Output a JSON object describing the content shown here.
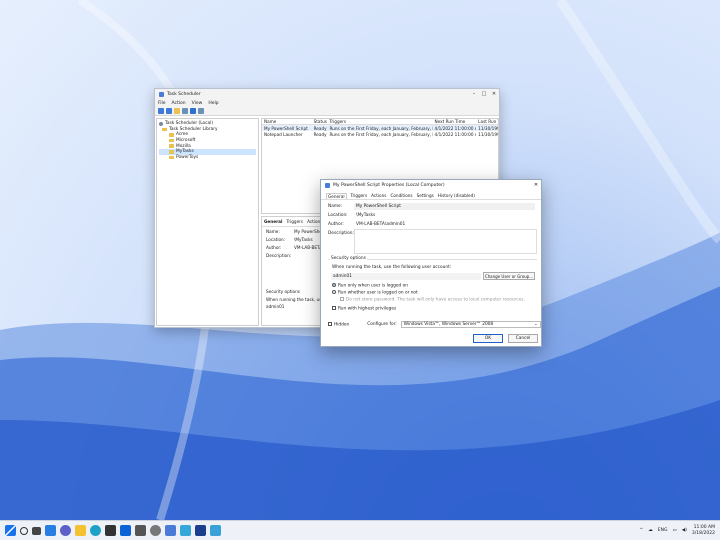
{
  "window": {
    "title": "Task Scheduler",
    "menu": [
      "File",
      "Action",
      "View",
      "Help"
    ],
    "tree": [
      {
        "label": "Task Scheduler (Local)",
        "level": 0,
        "icon": "clock-icon"
      },
      {
        "label": "Task Scheduler Library",
        "level": 1,
        "icon": "folder-icon"
      },
      {
        "label": "Acme",
        "level": 2,
        "icon": "folder-icon"
      },
      {
        "label": "Microsoft",
        "level": 2,
        "icon": "folder-icon"
      },
      {
        "label": "Mozilla",
        "level": 2,
        "icon": "folder-icon"
      },
      {
        "label": "MyTasks",
        "level": 2,
        "icon": "folder-icon",
        "selected": true
      },
      {
        "label": "PowerToys",
        "level": 2,
        "icon": "folder-icon"
      }
    ],
    "columns": [
      "Name",
      "Status",
      "Triggers",
      "Next Run Time",
      "Last Run T"
    ],
    "rows": [
      {
        "name": "My PowerShell Script",
        "status": "Ready",
        "triggers": "Runs on the First Friday, each January, February, Mar...",
        "next": "4/1/2022 11:00:00 A...",
        "last": "11/30/1999"
      },
      {
        "name": "Notepad Launcher",
        "status": "Ready",
        "triggers": "Runs on the First Friday, each January, February, Mar...",
        "next": "4/1/2022 11:00:00 A...",
        "last": "11/30/1999"
      }
    ],
    "detail_tabs": [
      "General",
      "Triggers",
      "Actions",
      "C"
    ],
    "detail": {
      "name_label": "Name:",
      "name": "My PowerShell",
      "location_label": "Location:",
      "location": "\\MyTasks",
      "author_label": "Author:",
      "author": "VM-LAB-BETA\\",
      "description_label": "Description:",
      "security": "Security options",
      "security_line": "When running the task, use t",
      "user": "admin01"
    }
  },
  "dialog": {
    "title": "My PowerShell Script Properties (Local Computer)",
    "tabs": [
      "General",
      "Triggers",
      "Actions",
      "Conditions",
      "Settings",
      "History (disabled)"
    ],
    "name_label": "Name:",
    "name": "My PowerShell Script",
    "location_label": "Location:",
    "location": "\\MyTasks",
    "author_label": "Author:",
    "author": "VM-LAB-BETA\\admin01",
    "description_label": "Description:",
    "security_title": "Security options",
    "account_line": "When running the task, use the following user account:",
    "account": "admin01",
    "change_user": "Change User or Group...",
    "radio_logged_on": "Run only when user is logged on",
    "radio_whether": "Run whether user is logged on or not",
    "no_password": "Do not store password. The task will only have access to local computer resources.",
    "highest": "Run with highest privileges",
    "hidden": "Hidden",
    "configure_label": "Configure for:",
    "configure_value": "Windows Vista™, Windows Server™ 2008",
    "ok": "OK",
    "cancel": "Cancel"
  },
  "taskbar": {
    "icons": [
      "windows-start-icon",
      "search-icon",
      "task-view-icon",
      "widgets-icon",
      "chat-icon",
      "file-explorer-icon",
      "edge-icon",
      "store-icon",
      "mail-icon",
      "terminal-icon",
      "settings-icon",
      "task-scheduler-icon",
      "notepad-icon",
      "powershell-icon",
      "app-icon"
    ],
    "lang": "ENG",
    "time": "11:00 AM",
    "date": "3/18/2022"
  }
}
